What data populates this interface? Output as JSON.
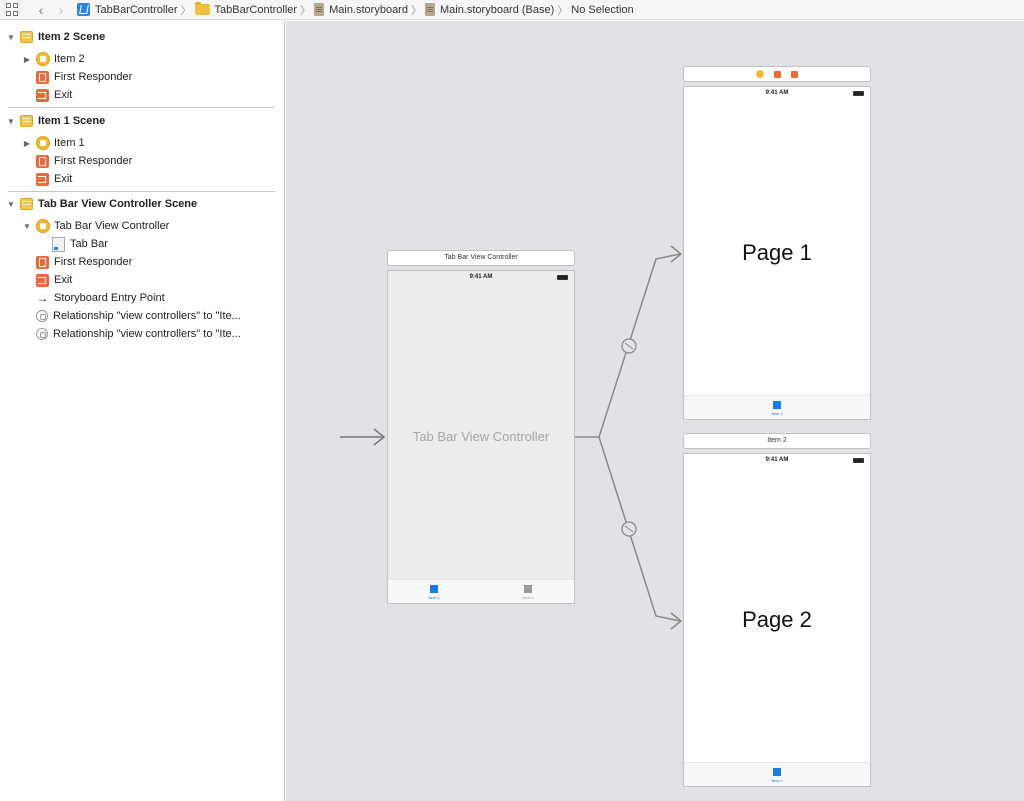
{
  "jumpbar": {
    "crumbs": [
      "TabBarController",
      "TabBarController",
      "Main.storyboard",
      "Main.storyboard (Base)",
      "No Selection"
    ]
  },
  "outline": {
    "scenes": [
      {
        "title": "Item 2 Scene",
        "items": [
          "Item 2",
          "First Responder",
          "Exit"
        ]
      },
      {
        "title": "Item 1 Scene",
        "items": [
          "Item 1",
          "First Responder",
          "Exit"
        ]
      },
      {
        "title": "Tab Bar View Controller Scene",
        "items": [
          "Tab Bar View Controller",
          "Tab Bar",
          "First Responder",
          "Exit",
          "Storyboard Entry Point",
          "Relationship \"view controllers\" to \"Ite...",
          "Relationship \"view controllers\" to \"Ite..."
        ]
      }
    ]
  },
  "canvas": {
    "tabbar_vc": {
      "title": "Tab Bar View Controller",
      "time": "9:41 AM",
      "center_label": "Tab Bar View Controller",
      "tabs": [
        "Item 1",
        "Item 2"
      ]
    },
    "page1": {
      "time": "9:41 AM",
      "label": "Page 1",
      "tab": "Item 1"
    },
    "page2": {
      "title": "Item 2",
      "time": "9:41 AM",
      "label": "Page 2",
      "tab": "Item 2"
    }
  },
  "colors": {
    "accent": "#1a7ae6",
    "inactive_tab": "#999999",
    "canvas_bg": "#e1e2e5"
  }
}
